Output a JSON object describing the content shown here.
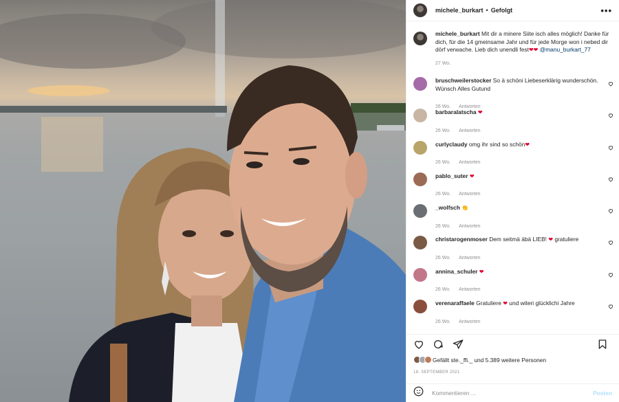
{
  "post": {
    "author": "michele_burkart",
    "separator": "•",
    "follow_status": "Gefolgt",
    "more": "•••"
  },
  "caption": {
    "author": "michele_burkart",
    "text": "Mit dir a minere Siite isch alles möglich! Danke für dich, für die 14 gmeinsame Jahr und für jede Morge won i nebed dir dörf verwache. Lieb dich unendli fest",
    "mention": "@manu_burkart_77",
    "time": "27 Wo."
  },
  "comments": [
    {
      "user": "bruschweilerstocker",
      "text": "So ä schöni Liebeserklärig wunderschön. Wünsch Alles Gutund",
      "time": "26 Wo.",
      "reply": "Antworten",
      "avatar_color": "#a56aa8"
    },
    {
      "user": "barbaralatscha",
      "text": "",
      "emoji": "heart",
      "time": "26 Wo.",
      "reply": "Antworten",
      "avatar_color": "#c9b5a4"
    },
    {
      "user": "curlyclaudy",
      "text": "omg ihr sind so schön",
      "emoji": "heart",
      "time": "26 Wo.",
      "reply": "Antworten",
      "avatar_color": "#b9a46a"
    },
    {
      "user": "pablo_suter",
      "text": "",
      "emoji": "heart",
      "time": "26 Wo.",
      "reply": "Antworten",
      "avatar_color": "#9c6b55"
    },
    {
      "user": "_wolfsch",
      "text": "",
      "emoji": "clap",
      "time": "26 Wo.",
      "reply": "Antworten",
      "avatar_color": "#6b6e72"
    },
    {
      "user": "christarogenmoser",
      "text": "Dem seitmä äbä LIEB! ",
      "text_after": " gratuliere",
      "emoji": "heart",
      "time": "26 Wo.",
      "reply": "Antworten",
      "avatar_color": "#7a5a45"
    },
    {
      "user": "annina_schuler",
      "text": "",
      "emoji": "heart",
      "time": "26 Wo.",
      "reply": "Antworten",
      "avatar_color": "#c2768a"
    },
    {
      "user": "verenaraffaele",
      "text": "Gratuliere ",
      "text_after": " und witeri glücklichi Jahre",
      "emoji": "heart",
      "time": "26 Wo.",
      "reply": "Antworten",
      "avatar_color": "#8a4f3c"
    }
  ],
  "likes": {
    "text": "Gefällt ste._ffi._ und 5.389 weitere Personen"
  },
  "date": "18. SEPTEMBER 2021",
  "composer": {
    "placeholder": "Kommentieren ...",
    "post_label": "Posten"
  },
  "colors": {
    "heart": "#e0002d",
    "link": "#00376b",
    "muted": "#8e8e8e",
    "post_button": "#b2dffc"
  }
}
